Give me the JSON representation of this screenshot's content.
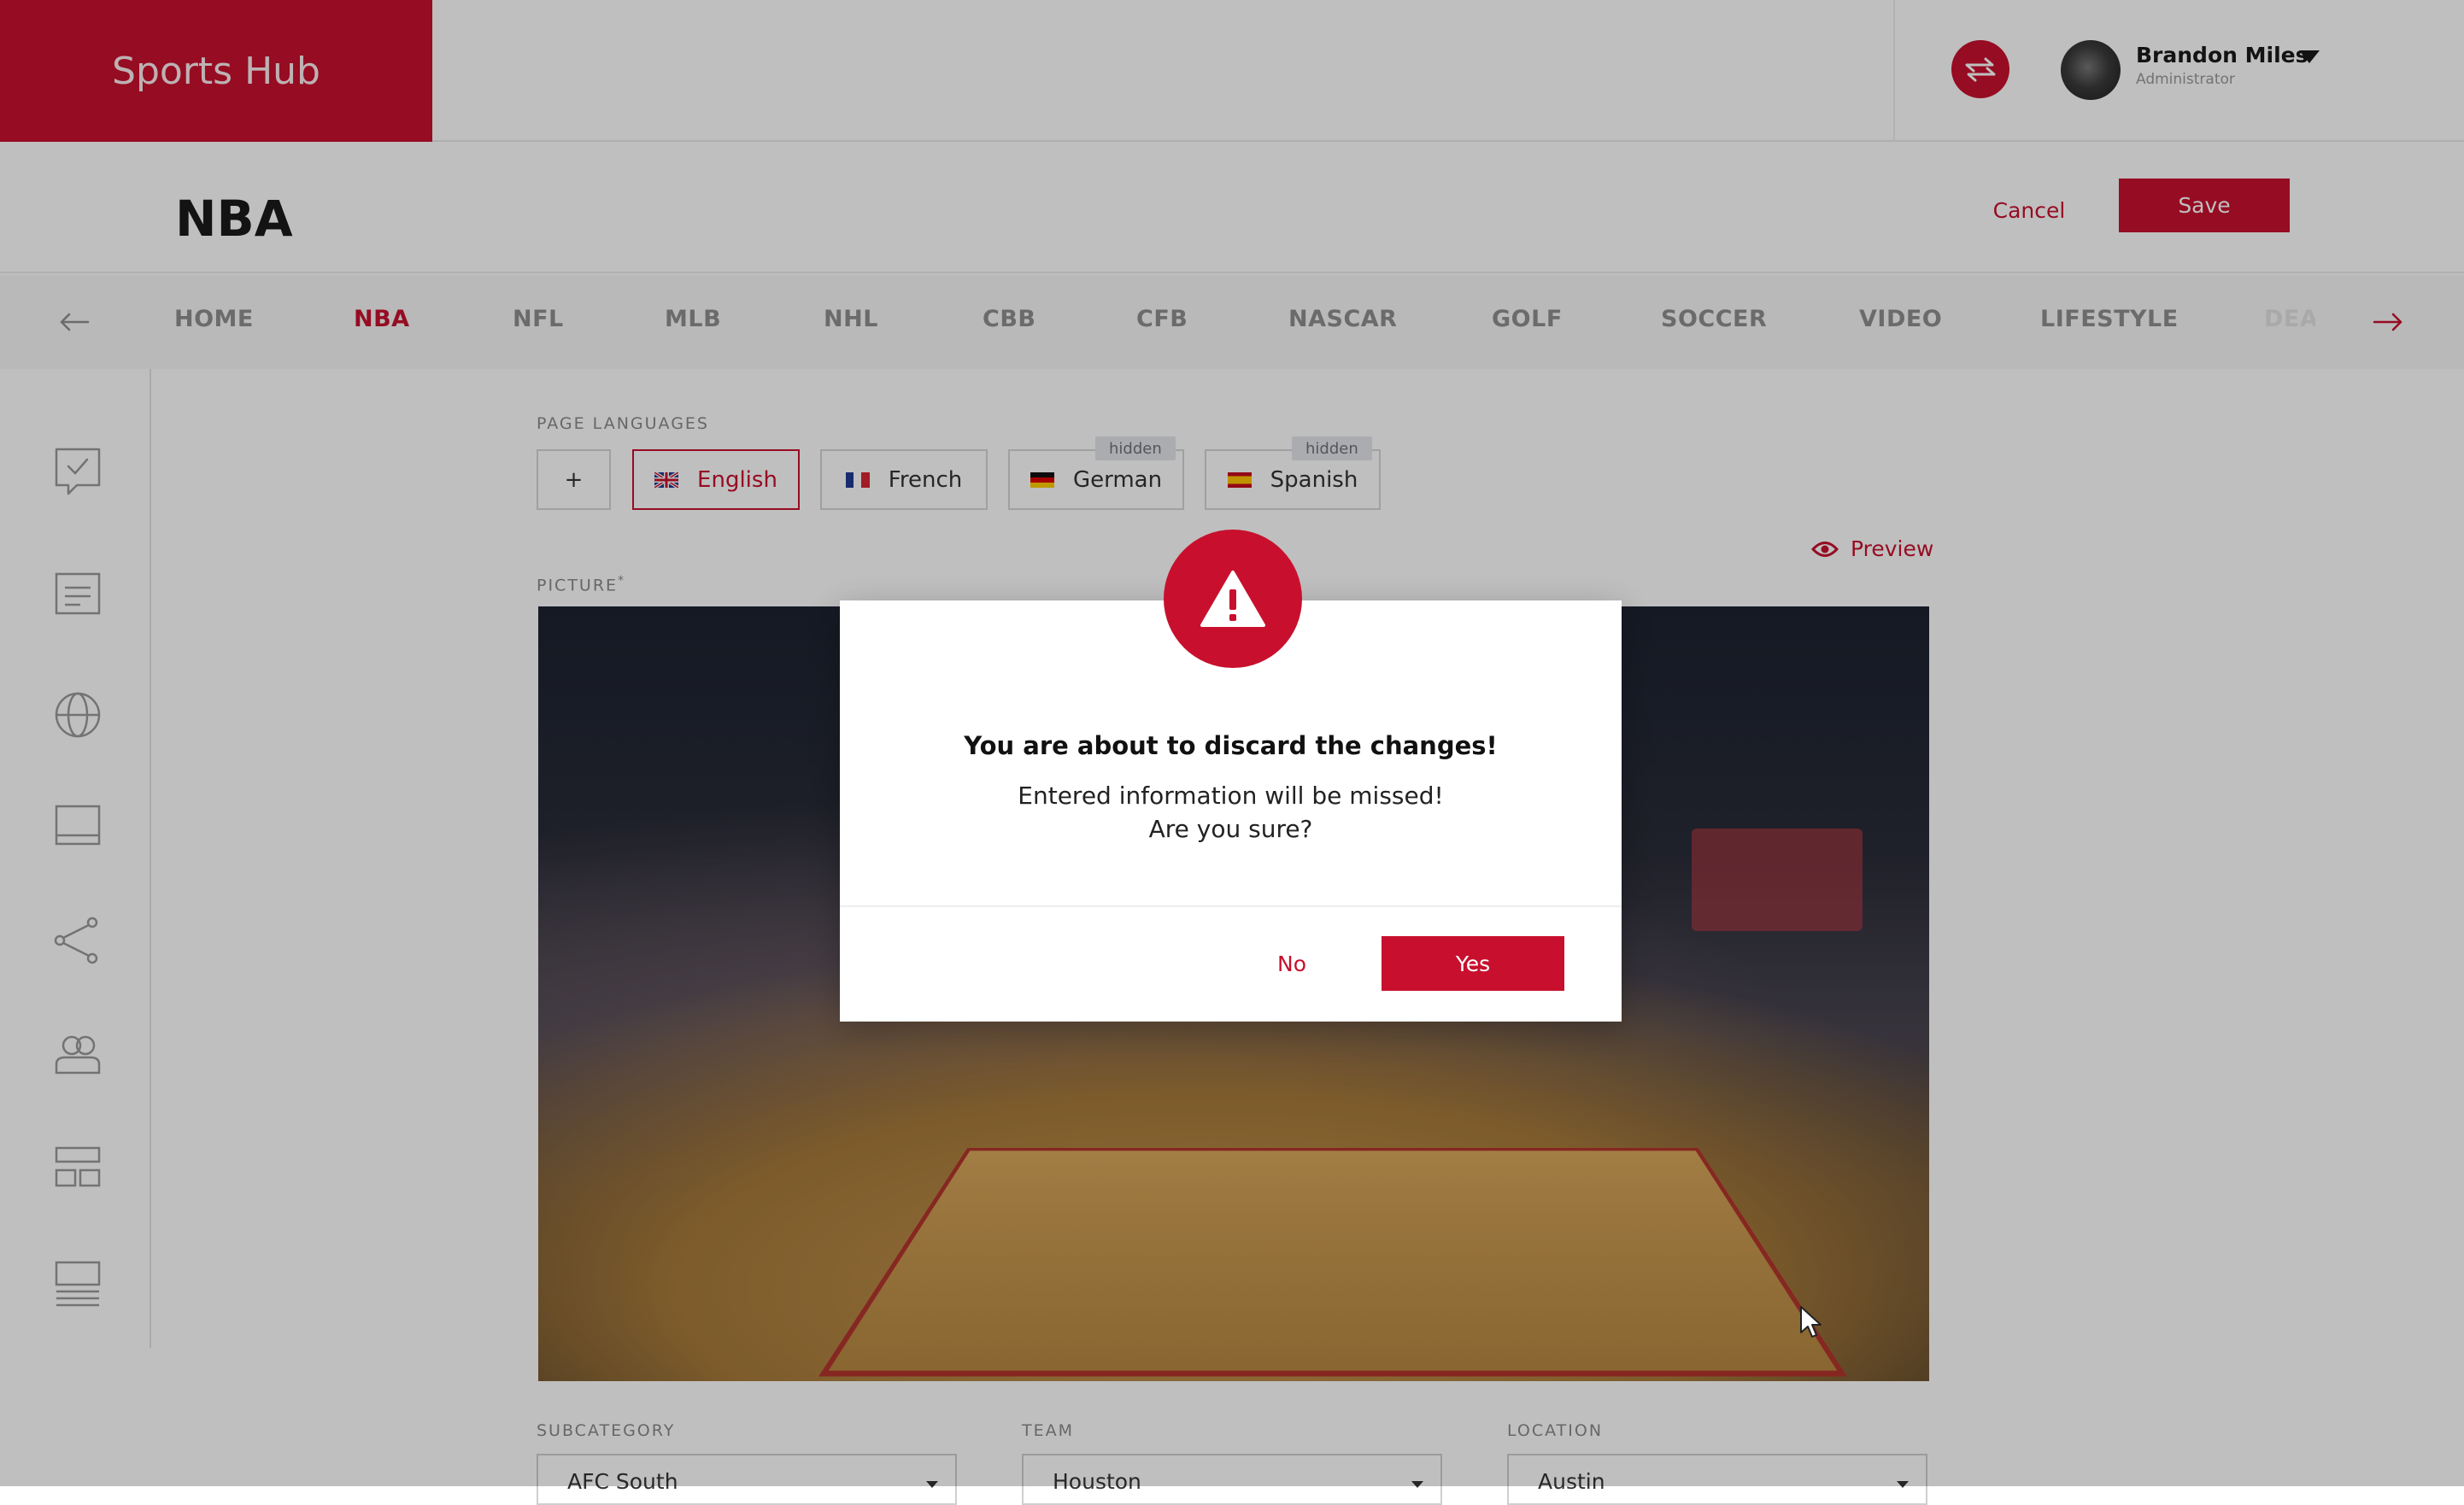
{
  "app": {
    "brand": "Sports Hub"
  },
  "user": {
    "name": "Brandon Miles",
    "role": "Administrator"
  },
  "page": {
    "title": "NBA",
    "cancel_label": "Cancel",
    "save_label": "Save"
  },
  "categories": [
    "HOME",
    "NBA",
    "NFL",
    "MLB",
    "NHL",
    "CBB",
    "CFB",
    "NASCAR",
    "GOLF",
    "SOCCER",
    "VIDEO",
    "LIFESTYLE",
    "DEA"
  ],
  "active_category": "NBA",
  "sidebar": {
    "icons": [
      "survey-icon",
      "document-icon",
      "globe-icon",
      "layout-icon",
      "share-icon",
      "users-icon",
      "blocks-icon",
      "list-icon"
    ]
  },
  "languages": {
    "label": "PAGE LANGUAGES",
    "add_label": "+",
    "items": [
      {
        "name": "English",
        "active": true,
        "hidden_tag": ""
      },
      {
        "name": "French",
        "active": false,
        "hidden_tag": ""
      },
      {
        "name": "German",
        "active": false,
        "hidden_tag": "hidden"
      },
      {
        "name": "Spanish",
        "active": false,
        "hidden_tag": "hidden"
      }
    ]
  },
  "preview_label": "Preview",
  "picture": {
    "label": "PICTURE",
    "required_mark": "*"
  },
  "fields": {
    "subcategory": {
      "label": "SUBCATEGORY",
      "value": "AFC South"
    },
    "team": {
      "label": "TEAM",
      "value": "Houston"
    },
    "location": {
      "label": "LOCATION",
      "value": "Austin"
    }
  },
  "dialog": {
    "title": "You are about to discard the changes!",
    "line1": "Entered information will be missed!",
    "line2": "Are you sure?",
    "no_label": "No",
    "yes_label": "Yes"
  },
  "colors": {
    "accent": "#c8102e",
    "overlay": "rgba(0,0,0,0.25)"
  }
}
